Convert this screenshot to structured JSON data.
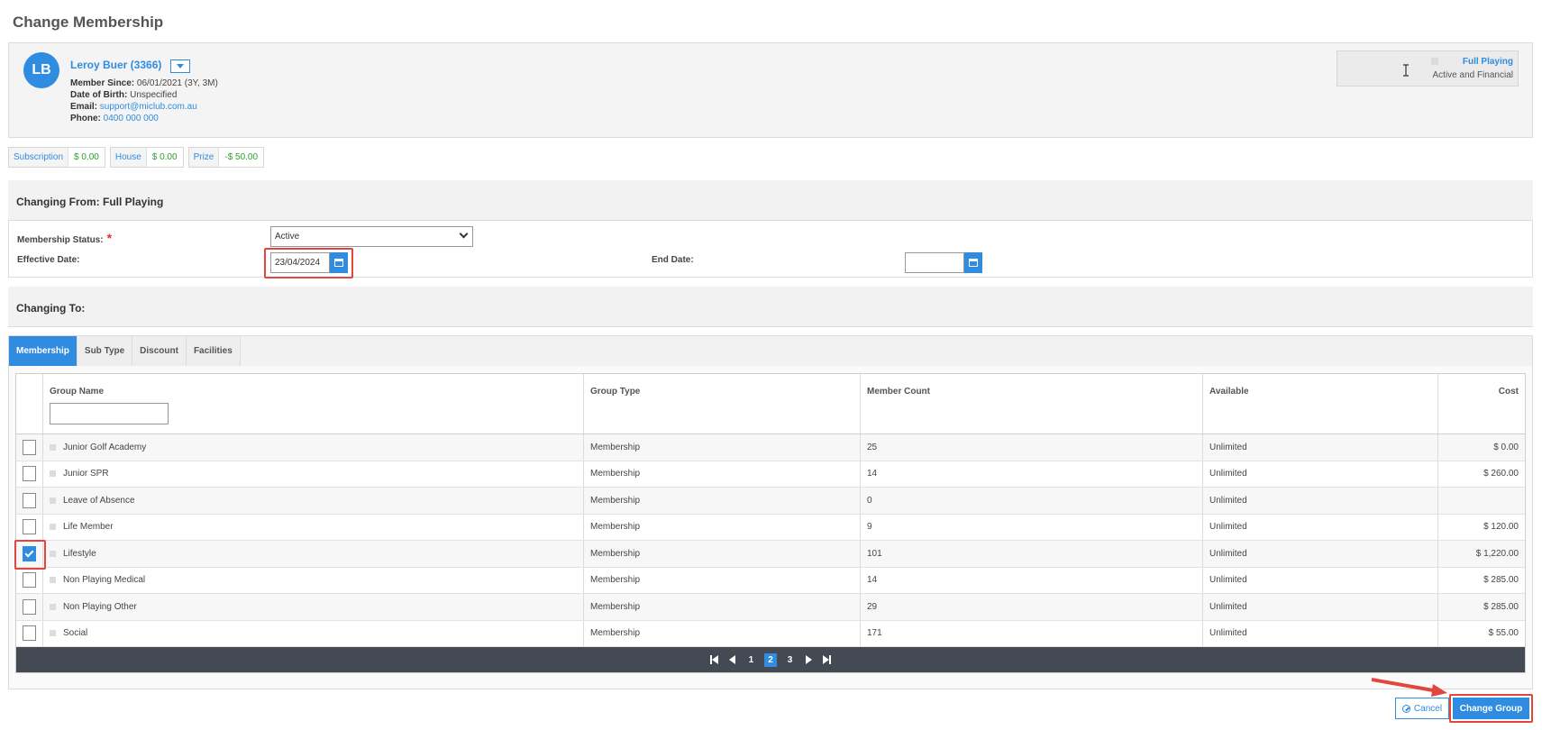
{
  "page": {
    "title": "Change Membership"
  },
  "member": {
    "initials": "LB",
    "name": "Leroy Buer (3366)",
    "member_since_label": "Member Since:",
    "member_since": "06/01/2021 (3Y, 3M)",
    "dob_label": "Date of Birth:",
    "dob": "Unspecified",
    "email_label": "Email:",
    "email": "support@miclub.com.au",
    "phone_label": "Phone:",
    "phone": "0400 000 000",
    "status_title": "Full Playing",
    "status_sub": "Active and Financial"
  },
  "balances": [
    {
      "label": "Subscription",
      "value": "$ 0.00"
    },
    {
      "label": "House",
      "value": "$ 0.00"
    },
    {
      "label": "Prize",
      "value": "-$ 50.00"
    }
  ],
  "changing_from": {
    "title": "Changing From: Full Playing",
    "status_label": "Membership Status:",
    "status_value": "Active",
    "effective_label": "Effective Date:",
    "effective_value": "23/04/2024",
    "end_label": "End Date:",
    "end_value": ""
  },
  "changing_to": {
    "title": "Changing To:",
    "tabs": [
      "Membership",
      "Sub Type",
      "Discount",
      "Facilities"
    ],
    "columns": [
      "Group Name",
      "Group Type",
      "Member Count",
      "Available",
      "Cost"
    ],
    "rows": [
      {
        "name": "Junior Golf Academy",
        "type": "Membership",
        "count": "25",
        "available": "Unlimited",
        "cost": "$ 0.00",
        "checked": false
      },
      {
        "name": "Junior SPR",
        "type": "Membership",
        "count": "14",
        "available": "Unlimited",
        "cost": "$ 260.00",
        "checked": false
      },
      {
        "name": "Leave of Absence",
        "type": "Membership",
        "count": "0",
        "available": "Unlimited",
        "cost": "",
        "checked": false
      },
      {
        "name": "Life Member",
        "type": "Membership",
        "count": "9",
        "available": "Unlimited",
        "cost": "$ 120.00",
        "checked": false
      },
      {
        "name": "Lifestyle",
        "type": "Membership",
        "count": "101",
        "available": "Unlimited",
        "cost": "$ 1,220.00",
        "checked": true
      },
      {
        "name": "Non Playing Medical",
        "type": "Membership",
        "count": "14",
        "available": "Unlimited",
        "cost": "$ 285.00",
        "checked": false
      },
      {
        "name": "Non Playing Other",
        "type": "Membership",
        "count": "29",
        "available": "Unlimited",
        "cost": "$ 285.00",
        "checked": false
      },
      {
        "name": "Social",
        "type": "Membership",
        "count": "171",
        "available": "Unlimited",
        "cost": "$ 55.00",
        "checked": false
      }
    ],
    "pages": [
      "1",
      "2",
      "3"
    ],
    "current_page": "2"
  },
  "actions": {
    "cancel": "Cancel",
    "change_group": "Change Group"
  },
  "colors": {
    "accent": "#2f8ce0",
    "highlight": "#e2463f",
    "positive": "#2ca02c",
    "pager_bg": "#434a54"
  },
  "icons": [
    "calendar-icon",
    "chevron-down-icon",
    "check-icon",
    "first-page-icon",
    "prev-page-icon",
    "next-page-icon",
    "last-page-icon",
    "ban-icon",
    "arrow-icon",
    "text-cursor-icon"
  ]
}
